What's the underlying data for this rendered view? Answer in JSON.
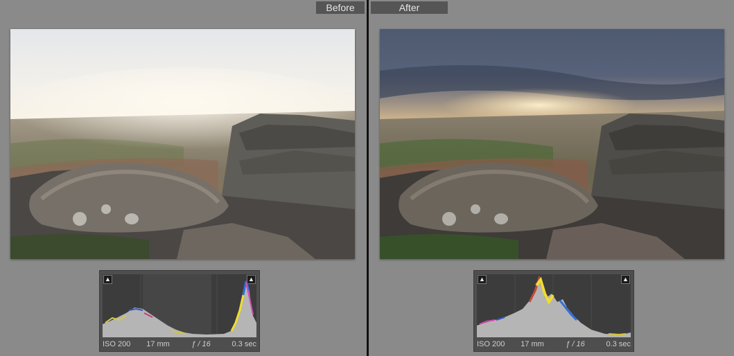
{
  "before": {
    "label": "Before",
    "histogram": {
      "clip_shadow_icon": "triangle-up",
      "clip_highlight_icon": "triangle-up",
      "iso": "ISO 200",
      "focal_length": "17 mm",
      "aperture": "ƒ / 16",
      "shutter": "0.3 sec"
    }
  },
  "after": {
    "label": "After",
    "histogram": {
      "clip_shadow_icon": "triangle-up",
      "clip_highlight_icon": "triangle-up",
      "iso": "ISO 200",
      "focal_length": "17 mm",
      "aperture": "ƒ / 16",
      "shutter": "0.3 sec"
    }
  },
  "colors": {
    "background": "#8a8a8a",
    "label_bg": "#555555",
    "divider": "#111111",
    "histogram_bg": "#3c3c3c"
  }
}
